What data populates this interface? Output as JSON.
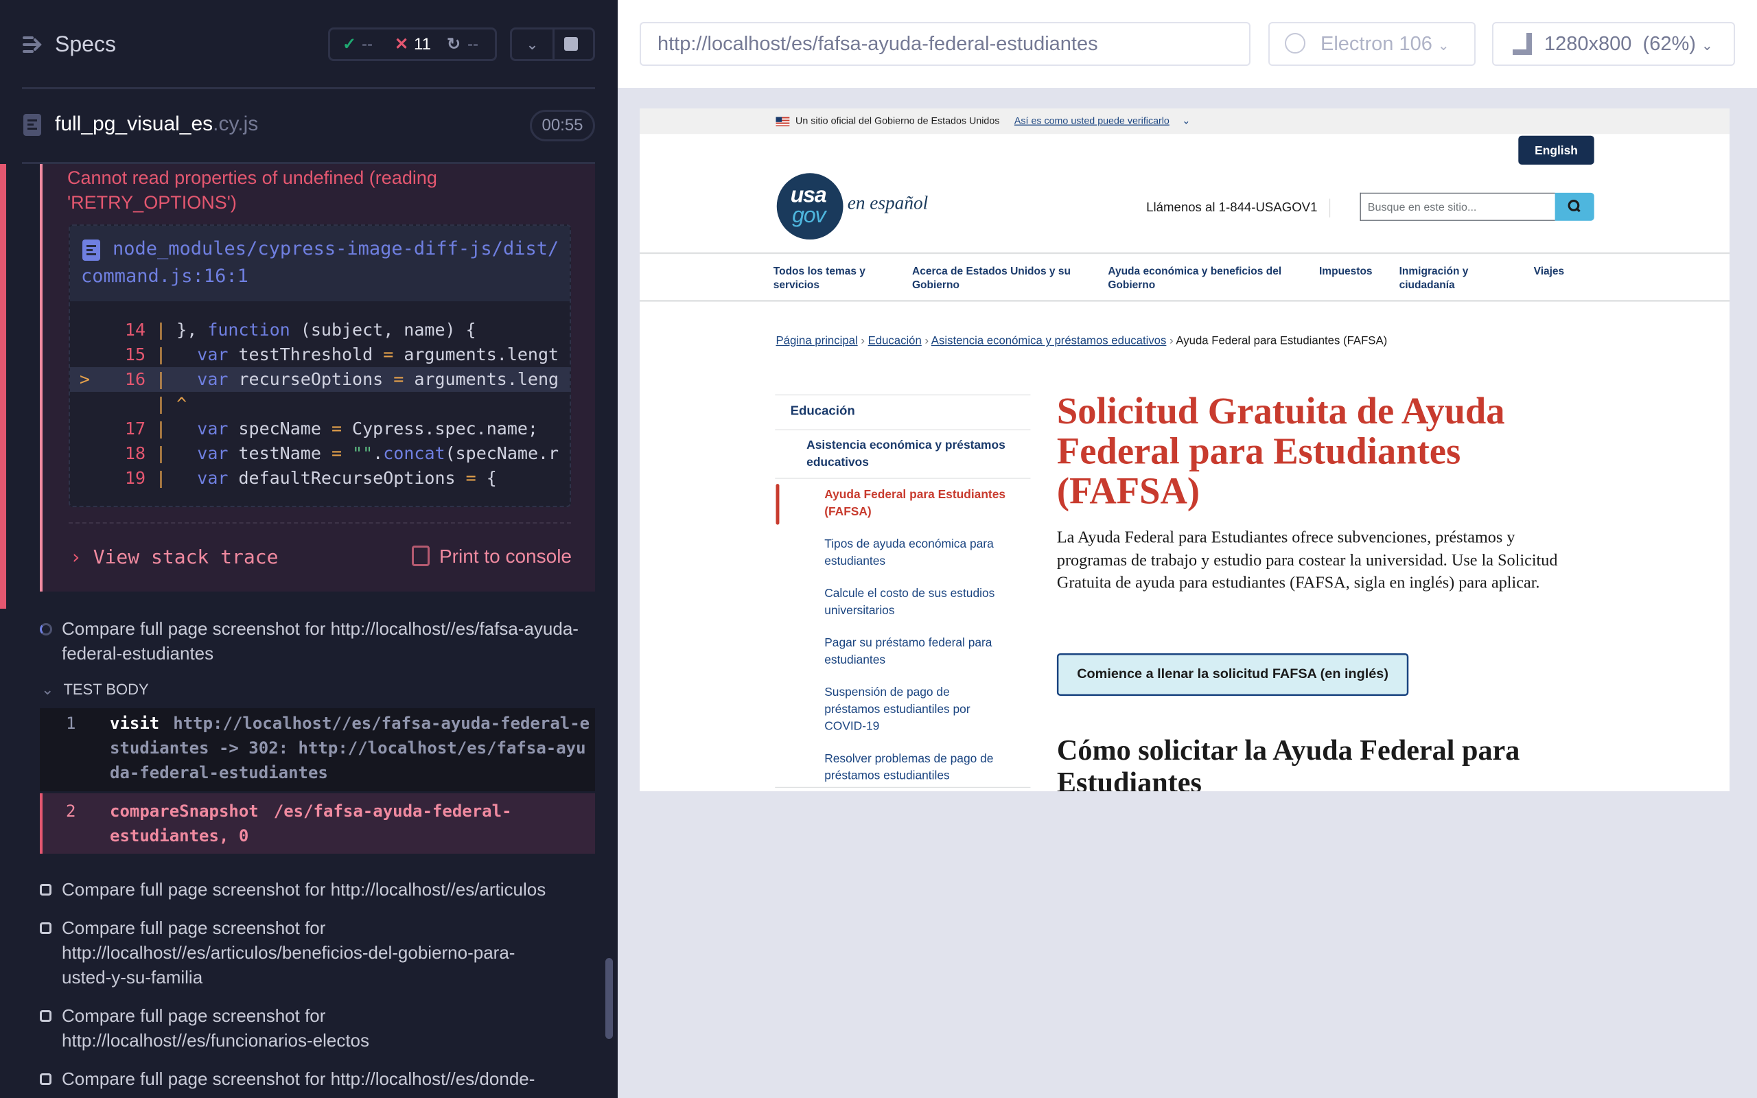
{
  "runner": {
    "header": {
      "title": "Specs",
      "passed": "--",
      "failed": "11",
      "pending": "--"
    },
    "spec": {
      "name": "full_pg_visual_es",
      "ext": ".cy.js",
      "duration": "00:55"
    },
    "error": {
      "message": "Cannot read properties of undefined (reading 'RETRY_OPTIONS')",
      "file_link": "node_modules/cypress-image-diff-js/dist/command.js:16:1",
      "code_lines": [
        {
          "num": "14",
          "marker": "",
          "code": "}, function (subject, name) {"
        },
        {
          "num": "15",
          "marker": "",
          "code": "  var testThreshold = arguments.lengt"
        },
        {
          "num": "16",
          "marker": ">",
          "code": "  var recurseOptions = arguments.leng"
        },
        {
          "num": "",
          "marker": "",
          "code": "^"
        },
        {
          "num": "17",
          "marker": "",
          "code": "  var specName = Cypress.spec.name;"
        },
        {
          "num": "18",
          "marker": "",
          "code": "  var testName = \"\".concat(specName.r"
        },
        {
          "num": "19",
          "marker": "",
          "code": "  var defaultRecurseOptions = {"
        }
      ],
      "view_stack_trace": "View stack trace",
      "print_to_console": "Print to console"
    },
    "current_test": {
      "title": "Compare full page screenshot for http://localhost//es/fafsa-ayuda-federal-estudiantes",
      "section": "TEST BODY",
      "commands": [
        {
          "num": "1",
          "name": "visit",
          "message": "http://localhost//es/fafsa-ayuda-federal-estudiantes -> 302: http://localhost/es/fafsa-ayuda-federal-estudiantes"
        },
        {
          "num": "2",
          "name": "compareSnapshot",
          "message": "/es/fafsa-ayuda-federal-estudiantes, 0"
        }
      ]
    },
    "tests": [
      "Compare full page screenshot for http://localhost//es/articulos",
      "Compare full page screenshot for http://localhost//es/articulos/beneficios-del-gobierno-para-usted-y-su-familia",
      "Compare full page screenshot for http://localhost//es/funcionarios-electos",
      "Compare full page screenshot for http://localhost//es/donde-"
    ]
  },
  "browser": {
    "url": "http://localhost/es/fafsa-ayuda-federal-estudiantes",
    "browser_name": "Electron 106",
    "viewport": "1280x800",
    "zoom": "(62%)"
  },
  "site": {
    "banner_text": "Un sitio oficial del Gobierno de Estados Unidos",
    "banner_link": "Así es como usted puede verificarlo",
    "english": "English",
    "logo_usa": "usa",
    "logo_gov": "gov",
    "logo_tagline": "en español",
    "phone": "Llámenos al 1-844-USAGOV1",
    "search_placeholder": "Busque en este sitio...",
    "nav": [
      "Todos los temas y servicios",
      "Acerca de Estados Unidos y su Gobierno",
      "Ayuda económica y beneficios del Gobierno",
      "Impuestos",
      "Inmigración y ciudadanía",
      "Viajes"
    ],
    "breadcrumb": [
      "Página principal",
      "Educación",
      "Asistencia económica y préstamos educativos",
      "Ayuda Federal para Estudiantes (FAFSA)"
    ],
    "sidenav": {
      "top": "Educación",
      "parent": "Asistencia económica y préstamos educativos",
      "current": "Ayuda Federal para Estudiantes (FAFSA)",
      "items": [
        "Tipos de ayuda económica para estudiantes",
        "Calcule el costo de sus estudios universitarios",
        "Pagar su préstamo federal para estudiantes",
        "Suspensión de pago de préstamos estudiantiles por COVID-19",
        "Resolver problemas de pago de préstamos estudiantiles"
      ]
    },
    "title": "Solicitud Gratuita de Ayuda Federal para Estudiantes (FAFSA)",
    "intro": "La Ayuda Federal para Estudiantes ofrece subvenciones, préstamos y programas de trabajo y estudio para costear la universidad. Use la Solicitud Gratuita de ayuda para estudiantes (FAFSA, sigla en inglés) para aplicar.",
    "cta": "Comience a llenar la solicitud FAFSA (en inglés)",
    "h2": "Cómo solicitar la Ayuda Federal para Estudiantes"
  },
  "colors": {
    "accent_red": "#c83b2e",
    "navy": "#1a3a6b",
    "cyan": "#4eb6de",
    "runner_bg": "#1b1e2e",
    "error_pink": "#e45770"
  }
}
